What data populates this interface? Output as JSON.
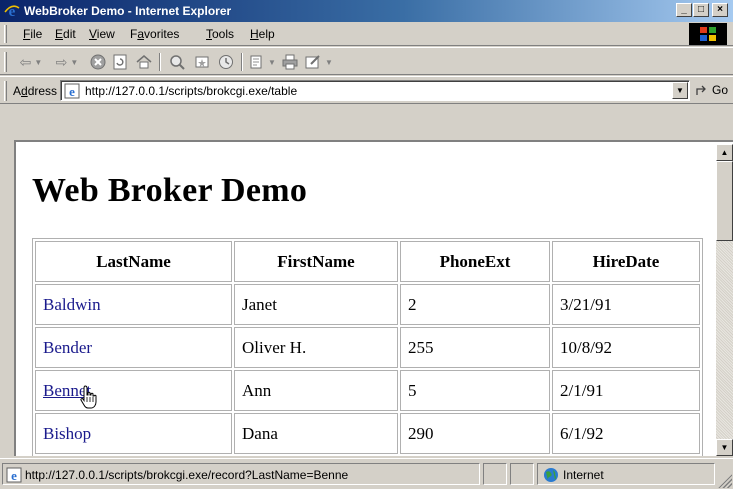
{
  "window": {
    "title": "WebBroker Demo - Internet Explorer",
    "buttons": {
      "minimize": "_",
      "maximize": "□",
      "close": "×"
    }
  },
  "menu": {
    "items": [
      {
        "label_u": "F",
        "label_rest": "ile"
      },
      {
        "label_u": "E",
        "label_rest": "dit"
      },
      {
        "label_u": "V",
        "label_rest": "iew"
      },
      {
        "label_pre": "F",
        "label_u": "a",
        "label_rest": "vorites"
      },
      {
        "label_u": "T",
        "label_rest": "ools"
      },
      {
        "label_u": "H",
        "label_rest": "elp"
      }
    ]
  },
  "toolbar": {
    "buttons": [
      "back-icon",
      "forward-icon",
      "stop-icon",
      "refresh-icon",
      "home-icon",
      "search-icon",
      "favorites-icon",
      "history-icon",
      "mail-icon",
      "print-icon",
      "edit-icon"
    ]
  },
  "address": {
    "label_pre": "A",
    "label_u": "d",
    "label_rest": "dress",
    "url": "http://127.0.0.1/scripts/brokcgi.exe/table",
    "go_label": "Go"
  },
  "page": {
    "heading": "Web Broker Demo",
    "table": {
      "headers": [
        "LastName",
        "FirstName",
        "PhoneExt",
        "HireDate"
      ],
      "rows": [
        {
          "last": "Baldwin",
          "first": "Janet",
          "ext": "2",
          "hire": "3/21/91"
        },
        {
          "last": "Bender",
          "first": "Oliver H.",
          "ext": "255",
          "hire": "10/8/92"
        },
        {
          "last": "Bennet",
          "first": "Ann",
          "ext": "5",
          "hire": "2/1/91"
        },
        {
          "last": "Bishop",
          "first": "Dana",
          "ext": "290",
          "hire": "6/1/92"
        }
      ]
    }
  },
  "status": {
    "url": "http://127.0.0.1/scripts/brokcgi.exe/record?LastName=Benne",
    "zone": "Internet"
  },
  "colors": {
    "link": "#1a1a8c",
    "titlebar_start": "#0a246a",
    "titlebar_end": "#a6caf0",
    "chrome": "#d4d0c8"
  }
}
